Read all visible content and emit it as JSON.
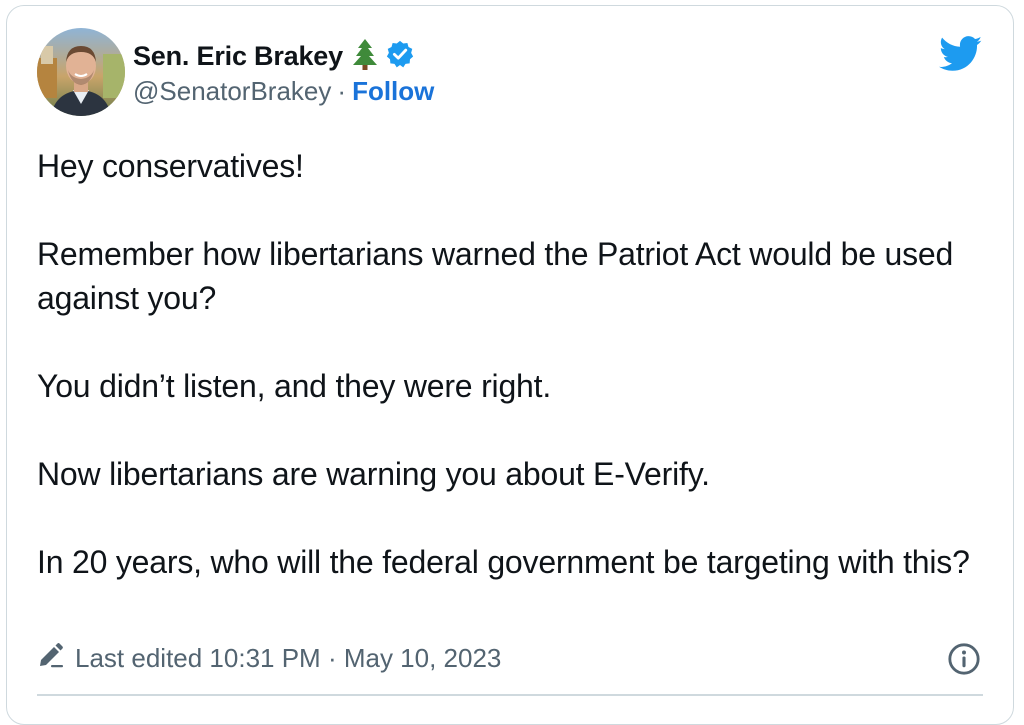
{
  "tweet": {
    "author": {
      "display_name": "Sen. Eric Brakey",
      "handle": "@SenatorBrakey",
      "separator": "·",
      "follow_label": "Follow",
      "name_emoji": "evergreen-tree-icon",
      "verified": true
    },
    "paragraphs": [
      "Hey conservatives!",
      "Remember how libertarians warned the Patriot Act would be used against you?",
      "You didn’t listen, and they were right.",
      "Now libertarians are warning you about E-Verify.",
      "In 20 years, who will the federal government be targeting with this?"
    ],
    "edited": {
      "label": "Last edited 10:31 PM · May 10, 2023"
    }
  },
  "icons": {
    "brand": "twitter-bird-icon",
    "edit": "pencil-icon",
    "info": "info-icon"
  },
  "colors": {
    "brand_blue": "#1d9bf0",
    "follow_blue": "#1a73d9",
    "text_primary": "#0f1419",
    "text_secondary": "#536471",
    "border": "#cfd9de"
  }
}
